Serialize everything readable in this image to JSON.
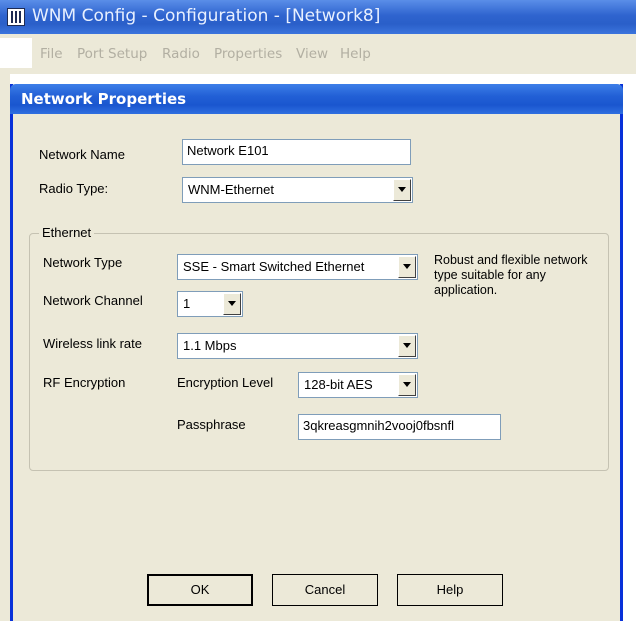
{
  "app": {
    "title": "WNM Config - Configuration - [Network8]",
    "menu": [
      "File",
      "Port Setup",
      "Radio",
      "Properties",
      "View",
      "Help"
    ]
  },
  "dialog": {
    "title": "Network Properties",
    "network_name": {
      "label": "Network Name",
      "value": "Network E101"
    },
    "radio_type": {
      "label": "Radio Type:",
      "value": "WNM-Ethernet"
    },
    "ethernet_group": {
      "legend": "Ethernet",
      "network_type": {
        "label": "Network Type",
        "value": "SSE - Smart Switched Ethernet"
      },
      "network_type_description": "Robust and flexible network type suitable for any application.",
      "network_channel": {
        "label": "Network Channel",
        "value": "1"
      },
      "wireless_link_rate": {
        "label": "Wireless link rate",
        "value": "1.1 Mbps"
      },
      "rf_encryption": {
        "label": "RF Encryption",
        "encryption_level_label": "Encryption Level",
        "encryption_level_value": "128-bit AES",
        "passphrase_label": "Passphrase",
        "passphrase_value": "3qkreasgmnih2vooj0fbsnfl"
      }
    },
    "buttons": {
      "ok": "OK",
      "cancel": "Cancel",
      "help": "Help"
    }
  }
}
